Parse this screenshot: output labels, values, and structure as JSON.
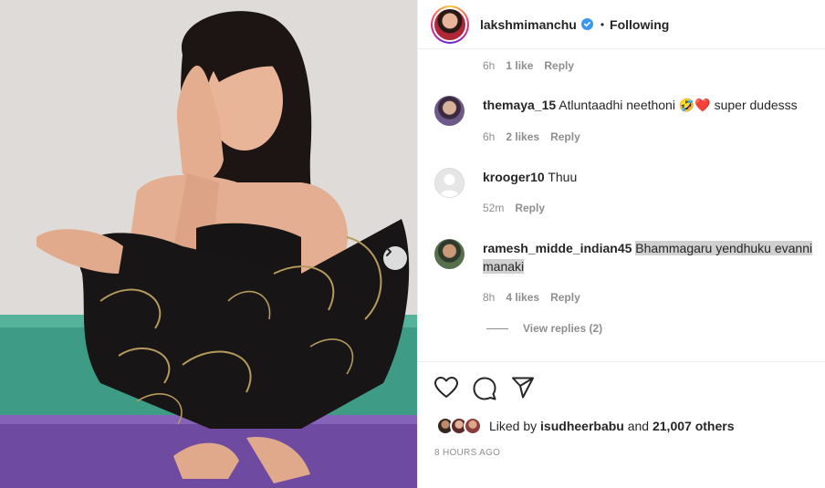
{
  "post": {
    "username": "lakshmimanchu",
    "follow_state": "Following",
    "dot": "•"
  },
  "comments": [
    {
      "username": "",
      "text": "",
      "time": "6h",
      "likes": "1 like",
      "reply": "Reply"
    },
    {
      "username": "themaya_15",
      "text": "Atluntaadhi neethoni 🤣❤️ super dudesss",
      "time": "6h",
      "likes": "2 likes",
      "reply": "Reply"
    },
    {
      "username": "krooger10",
      "text": "Thuu",
      "time": "52m",
      "likes": "",
      "reply": "Reply"
    },
    {
      "username": "ramesh_midde_indian45",
      "text": "Bhammagaru yendhuku evanni manaki",
      "time": "8h",
      "likes": "4 likes",
      "reply": "Reply"
    }
  ],
  "view_replies": "View replies (2)",
  "likes": {
    "prefix": "Liked by",
    "user": "isudheerbabu",
    "and": "and",
    "others": "21,007 others"
  },
  "time_ago": "8 HOURS AGO",
  "icons": [
    "heart-icon",
    "comment-icon",
    "share-icon",
    "chevron-right-icon",
    "verified-badge-icon"
  ],
  "colors": {
    "accent": "#3897f0",
    "muted": "#8e8e8e",
    "text": "#262626"
  }
}
